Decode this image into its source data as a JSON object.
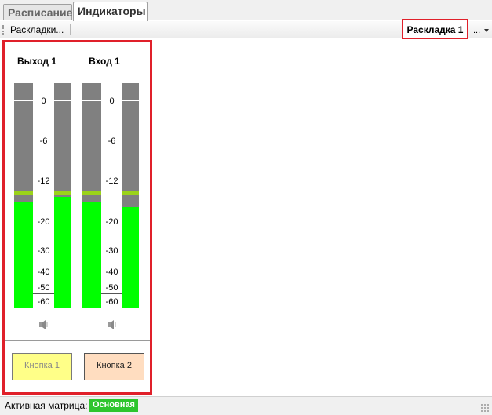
{
  "tabs": [
    {
      "label": "Расписание",
      "active": false
    },
    {
      "label": "Индикаторы",
      "active": true
    }
  ],
  "toolbar": {
    "layouts_button": "Раскладки...",
    "current_layout": "Раскладка 1",
    "more": "..."
  },
  "meters": [
    {
      "title": "Выход 1",
      "icon": "speaker-icon",
      "left_level_db": -15,
      "right_level_db": -14,
      "left_peak_db": -13,
      "right_peak_db": -13,
      "scale": [
        "0",
        "-6",
        "-12",
        "-20",
        "-30",
        "-40",
        "-50",
        "-60"
      ]
    },
    {
      "title": "Вход 1",
      "icon": "speaker-icon",
      "left_level_db": -15,
      "right_level_db": -16,
      "left_peak_db": -13,
      "right_peak_db": -13,
      "scale": [
        "0",
        "-6",
        "-12",
        "-20",
        "-30",
        "-40",
        "-50",
        "-60"
      ]
    }
  ],
  "buttons": {
    "button1": "Кнопка 1",
    "button2": "Кнопка 2"
  },
  "status": {
    "label": "Активная матрица:",
    "value": "Основная"
  },
  "colors": {
    "highlight_border": "#e0202a",
    "level_green": "#00ff00",
    "peak_line": "#9bd31a",
    "status_badge": "#2dc52d"
  }
}
